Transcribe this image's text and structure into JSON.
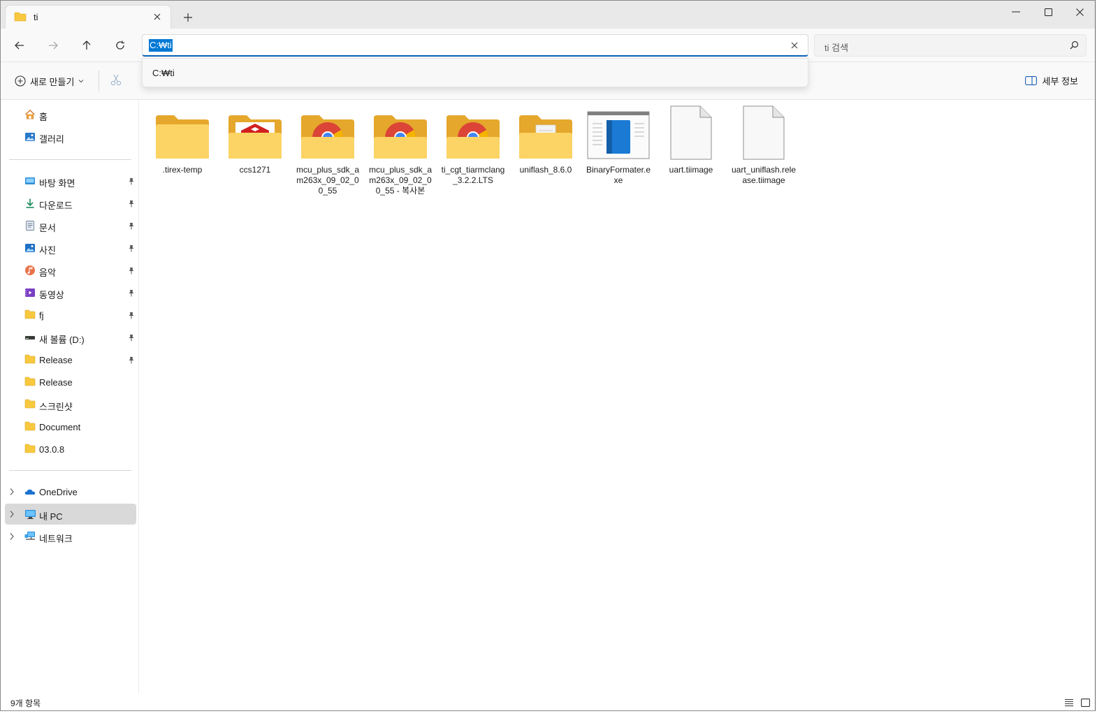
{
  "tab": {
    "title": "ti"
  },
  "address": {
    "value": "C:₩ti",
    "suggestion": "C:₩ti"
  },
  "search": {
    "placeholder": "ti 검색"
  },
  "toolbar": {
    "new_label": "새로 만들기",
    "details_label": "세부 정보"
  },
  "sidebar": {
    "top": [
      {
        "label": "홈",
        "icon": "home-icon"
      },
      {
        "label": "갤러리",
        "icon": "gallery-icon"
      }
    ],
    "quick_access": [
      {
        "label": "바탕 화면",
        "icon": "desktop-icon",
        "pinned": true
      },
      {
        "label": "다운로드",
        "icon": "download-icon",
        "pinned": true
      },
      {
        "label": "문서",
        "icon": "documents-icon",
        "pinned": true
      },
      {
        "label": "사진",
        "icon": "pictures-icon",
        "pinned": true
      },
      {
        "label": "음악",
        "icon": "music-icon",
        "pinned": true
      },
      {
        "label": "동영상",
        "icon": "videos-icon",
        "pinned": true
      },
      {
        "label": "fj",
        "icon": "folder-icon",
        "pinned": true
      },
      {
        "label": "새 볼륨 (D:)",
        "icon": "drive-icon",
        "pinned": true
      },
      {
        "label": "Release",
        "icon": "folder-icon",
        "pinned": true
      },
      {
        "label": "Release",
        "icon": "folder-icon",
        "pinned": false
      },
      {
        "label": "스크린샷",
        "icon": "folder-icon",
        "pinned": false
      },
      {
        "label": "Document",
        "icon": "folder-icon",
        "pinned": false
      },
      {
        "label": "03.0.8",
        "icon": "folder-icon",
        "pinned": false
      }
    ],
    "locations": [
      {
        "label": "OneDrive",
        "icon": "onedrive-icon"
      },
      {
        "label": "내 PC",
        "icon": "this-pc-icon",
        "selected": true
      },
      {
        "label": "네트워크",
        "icon": "network-icon"
      }
    ]
  },
  "files": [
    {
      "name": ".tirex-temp",
      "type": "folder"
    },
    {
      "name": "ccs1271",
      "type": "folder-ccs"
    },
    {
      "name": "mcu_plus_sdk_am263x_09_02_00_55",
      "type": "folder-chrome"
    },
    {
      "name": "mcu_plus_sdk_am263x_09_02_00_55 - 복사본",
      "type": "folder-chrome"
    },
    {
      "name": "ti_cgt_tiarmclang_3.2.2.LTS",
      "type": "folder-chrome"
    },
    {
      "name": "uniflash_8.6.0",
      "type": "folder-doc"
    },
    {
      "name": "BinaryFormater.exe",
      "type": "exe"
    },
    {
      "name": "uart.tiimage",
      "type": "file"
    },
    {
      "name": "uart_uniflash.release.tiimage",
      "type": "file"
    }
  ],
  "status": {
    "count": "9개 항목"
  },
  "colors": {
    "accent": "#0078d4",
    "folder": "#f8c93f",
    "selected_bg": "#d9d9d9"
  }
}
